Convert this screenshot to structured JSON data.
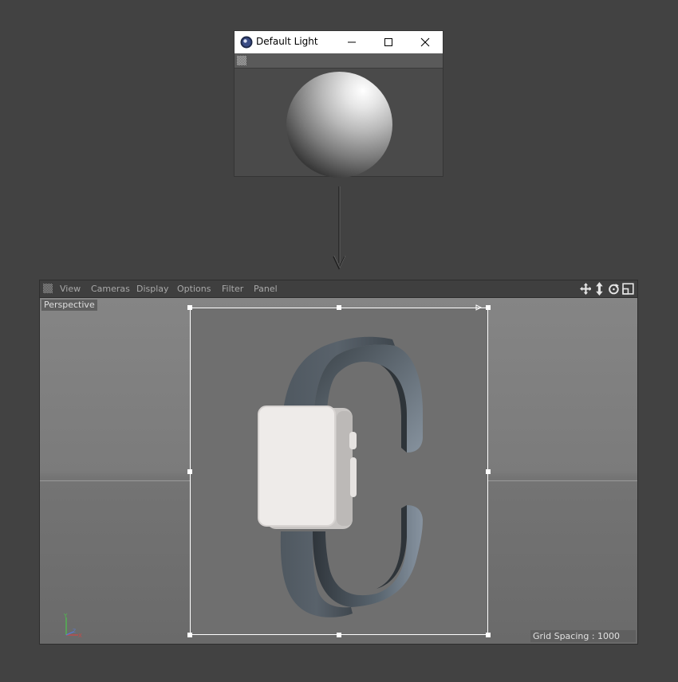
{
  "popup": {
    "title": "Default Light",
    "controls": [
      "minimize-icon",
      "maximize-icon",
      "close-icon"
    ],
    "preview": "sphere-preview"
  },
  "viewport": {
    "menu": [
      "View",
      "Cameras",
      "Display",
      "Options",
      "Filter",
      "Panel"
    ],
    "nav_icons": [
      "move-view-icon",
      "pan-view-icon",
      "rotate-view-icon",
      "toggle-layout-icon"
    ],
    "camera_label": "Perspective",
    "grid_spacing": "Grid Spacing : 1000 cm",
    "accent": "#ffffff"
  }
}
